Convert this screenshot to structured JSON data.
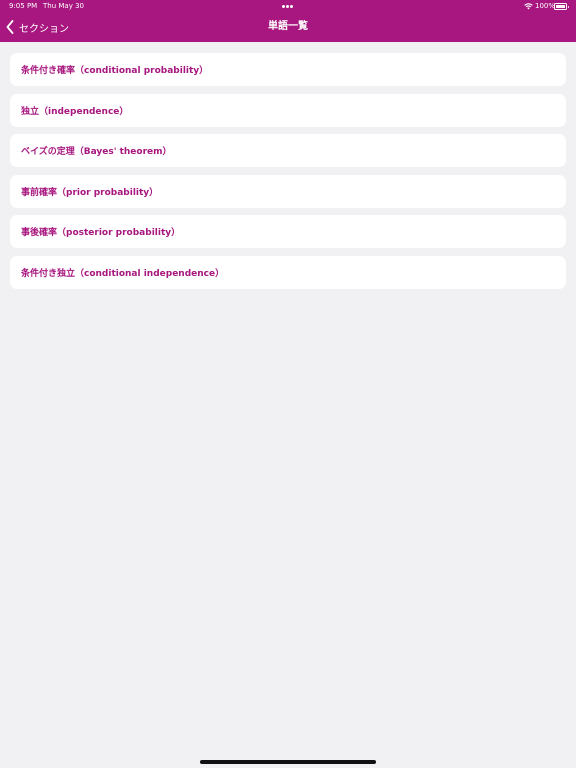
{
  "status_bar": {
    "time": "9:05 PM",
    "date": "Thu May 30",
    "battery": "100%"
  },
  "nav": {
    "back_label": "セクション",
    "title": "単語一覧"
  },
  "terms": [
    {
      "label": "条件付き確率（conditional probability）"
    },
    {
      "label": "独立（independence）"
    },
    {
      "label": "ベイズの定理（Bayes' theorem）"
    },
    {
      "label": "事前確率（prior probability）"
    },
    {
      "label": "事後確率（posterior probability）"
    },
    {
      "label": "条件付き独立（conditional independence）"
    }
  ],
  "colors": {
    "accent": "#a7177f",
    "background": "#f1f1f3",
    "card": "#ffffff"
  }
}
